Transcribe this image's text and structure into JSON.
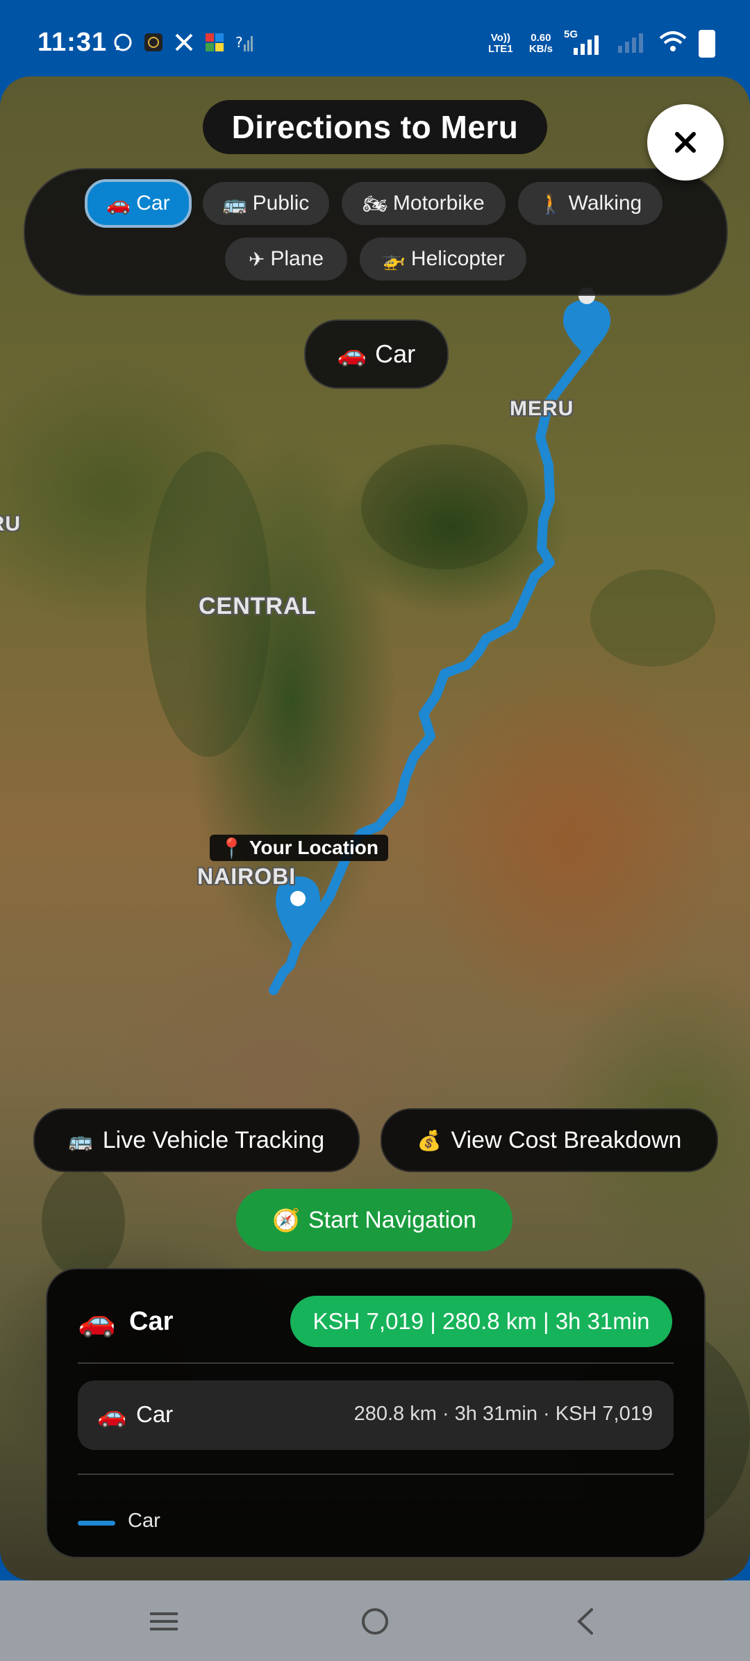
{
  "status_bar": {
    "time": "11:31",
    "left_icons": [
      "whatsapp-icon",
      "app-icon",
      "x-icon",
      "app-grid-icon",
      "signal-question-icon"
    ],
    "volte": "Vo)) LTE1",
    "speed_value": "0.60",
    "speed_unit": "KB/s",
    "network": "5G"
  },
  "header": {
    "title": "Directions to Meru",
    "close_label": "✕"
  },
  "modes": [
    {
      "icon": "🚗",
      "label": "Car",
      "active": true
    },
    {
      "icon": "🚌",
      "label": "Public",
      "active": false
    },
    {
      "icon": "🏍",
      "label": "Motorbike",
      "active": false
    },
    {
      "icon": "🚶",
      "label": "Walking",
      "active": false
    },
    {
      "icon": "✈",
      "label": "Plane",
      "active": false
    },
    {
      "icon": "🚁",
      "label": "Helicopter",
      "active": false
    }
  ],
  "map": {
    "selected_mode_icon": "🚗",
    "selected_mode_label": "Car",
    "labels": {
      "meru": "MERU",
      "central": "CENTRAL",
      "nairobi": "NAIROBI",
      "uru": "URU"
    },
    "location_icon": "📍",
    "location_label": "Your Location",
    "route_color": "#1e88d2"
  },
  "actions": {
    "tracking_icon": "🚌",
    "tracking_label": "Live Vehicle Tracking",
    "cost_icon": "💰",
    "cost_label": "View Cost Breakdown",
    "start_icon": "🧭",
    "start_label": "Start Navigation"
  },
  "summary": {
    "icon": "🚗",
    "mode": "Car",
    "badge": "KSH 7,019 | 280.8 km | 3h 31min",
    "route": {
      "icon": "🚗",
      "name": "Car",
      "detail": "280.8 km · 3h 31min · KSH 7,019"
    },
    "legend_label": "Car"
  },
  "nav_bar": {
    "icons": [
      "recents-icon",
      "home-icon",
      "back-icon"
    ]
  }
}
